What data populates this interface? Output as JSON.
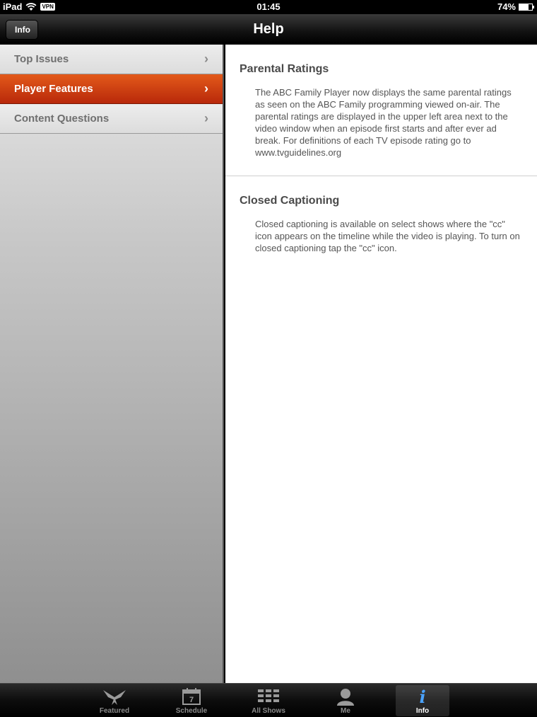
{
  "status_bar": {
    "device": "iPad",
    "vpn": "VPN",
    "time": "01:45",
    "battery": "74%",
    "battery_level": 0.74
  },
  "nav": {
    "back_label": "Info",
    "title": "Help"
  },
  "sidebar": {
    "items": [
      {
        "label": "Top Issues",
        "active": false
      },
      {
        "label": "Player Features",
        "active": true
      },
      {
        "label": "Content Questions",
        "active": false
      }
    ]
  },
  "main": {
    "sections": [
      {
        "title": "Parental Ratings",
        "body": "The ABC Family Player now displays the same parental ratings as seen on the ABC Family programming viewed on-air. The parental ratings are displayed in the upper left area next to the video window when an episode first starts and after ever ad break. For definitions of each TV episode rating go to www.tvguidelines.org"
      },
      {
        "title": "Closed Captioning",
        "body": "Closed captioning is available on select shows where the \"cc\" icon appears on the timeline while the video is playing. To turn on closed captioning tap the \"cc\" icon."
      }
    ]
  },
  "tab_bar": {
    "tabs": [
      {
        "label": "Featured",
        "icon": "featured-icon"
      },
      {
        "label": "Schedule",
        "icon": "calendar-icon",
        "icon_text": "7"
      },
      {
        "label": "All Shows",
        "icon": "grid-icon"
      },
      {
        "label": "Me",
        "icon": "person-icon"
      },
      {
        "label": "Info",
        "icon": "info-icon",
        "icon_text": "i",
        "active": true
      }
    ]
  }
}
